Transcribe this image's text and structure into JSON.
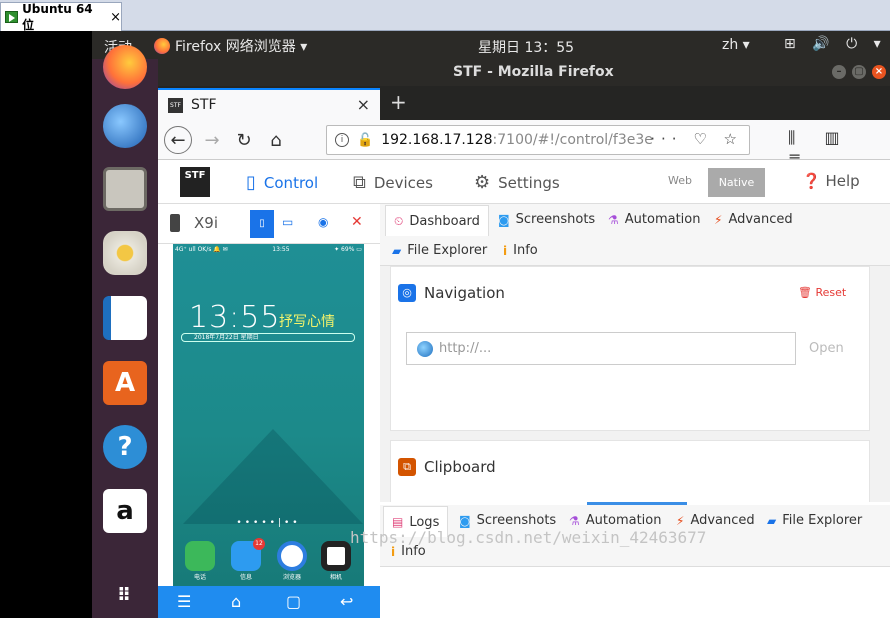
{
  "vm": {
    "tab_label": "Ubuntu 64 位",
    "close": "×"
  },
  "topbar": {
    "activities": "活动",
    "app_name": "Firefox 网络浏览器 ▾",
    "clock": "星期日 13：55",
    "lang": "zh ▾",
    "tray": "⊞ 🔊 ⏻ ▾"
  },
  "firefox": {
    "window_title": "STF - Mozilla Firefox",
    "tab_title": "STF",
    "tab_close": "×",
    "new_tab": "+",
    "url_host": "192.168.17.128",
    "url_rest": ":7100/#!/control/f3e3e",
    "url_actions": "··· ♡ ☆",
    "toolbar_right": "⫼ ▥ ≡"
  },
  "stf_nav": {
    "logo": "STF",
    "control": "Control",
    "devices": "Devices",
    "settings": "Settings",
    "web": "Web",
    "native": "Native",
    "help": "Help"
  },
  "device": {
    "name": "X9i",
    "status_left": "4G⁺ ull OK/s 🔔 ✉",
    "status_center": "13:55",
    "status_right": "✦ 69% ▭",
    "time": "13:55",
    "motto": "抒写心情",
    "date": "2018年7月22日   星期日",
    "page_dots": "•••••|••",
    "apps": [
      {
        "label": "电话",
        "color": "#3cb85a"
      },
      {
        "label": "信息",
        "color": "#2d9bf0",
        "badge": "12"
      },
      {
        "label": "浏览器",
        "color": "#2d7de0"
      },
      {
        "label": "相机",
        "color": "#222222"
      }
    ],
    "footer": [
      "☰",
      "⌂",
      "▢",
      "↩"
    ]
  },
  "right_tabs": [
    {
      "label": "Dashboard",
      "icon": "⏲",
      "color": "#e0457b"
    },
    {
      "label": "Screenshots",
      "icon": "◙",
      "color": "#2d9bf0"
    },
    {
      "label": "Automation",
      "icon": "⚗",
      "color": "#a64fd9"
    },
    {
      "label": "Advanced",
      "icon": "⚡",
      "color": "#e64a19"
    },
    {
      "label": "File Explorer",
      "icon": "▰",
      "color": "#1a73e8"
    },
    {
      "label": "Info",
      "icon": "i",
      "color": "#f39c12"
    }
  ],
  "navigation_card": {
    "title": "Navigation",
    "reset": "Reset",
    "placeholder": "http://...",
    "open": "Open"
  },
  "clipboard_card": {
    "title": "Clipboard"
  },
  "bottom_tabs": [
    {
      "label": "Logs",
      "icon": "▤",
      "color": "#e0457b"
    },
    {
      "label": "Screenshots",
      "icon": "◙",
      "color": "#2d9bf0"
    },
    {
      "label": "Automation",
      "icon": "⚗",
      "color": "#a64fd9"
    },
    {
      "label": "Advanced",
      "icon": "⚡",
      "color": "#e64a19"
    },
    {
      "label": "File Explorer",
      "icon": "▰",
      "color": "#1a73e8"
    },
    {
      "label": "Info",
      "icon": "i",
      "color": "#f39c12"
    }
  ],
  "watermark": "https://blog.csdn.net/weixin_42463677"
}
